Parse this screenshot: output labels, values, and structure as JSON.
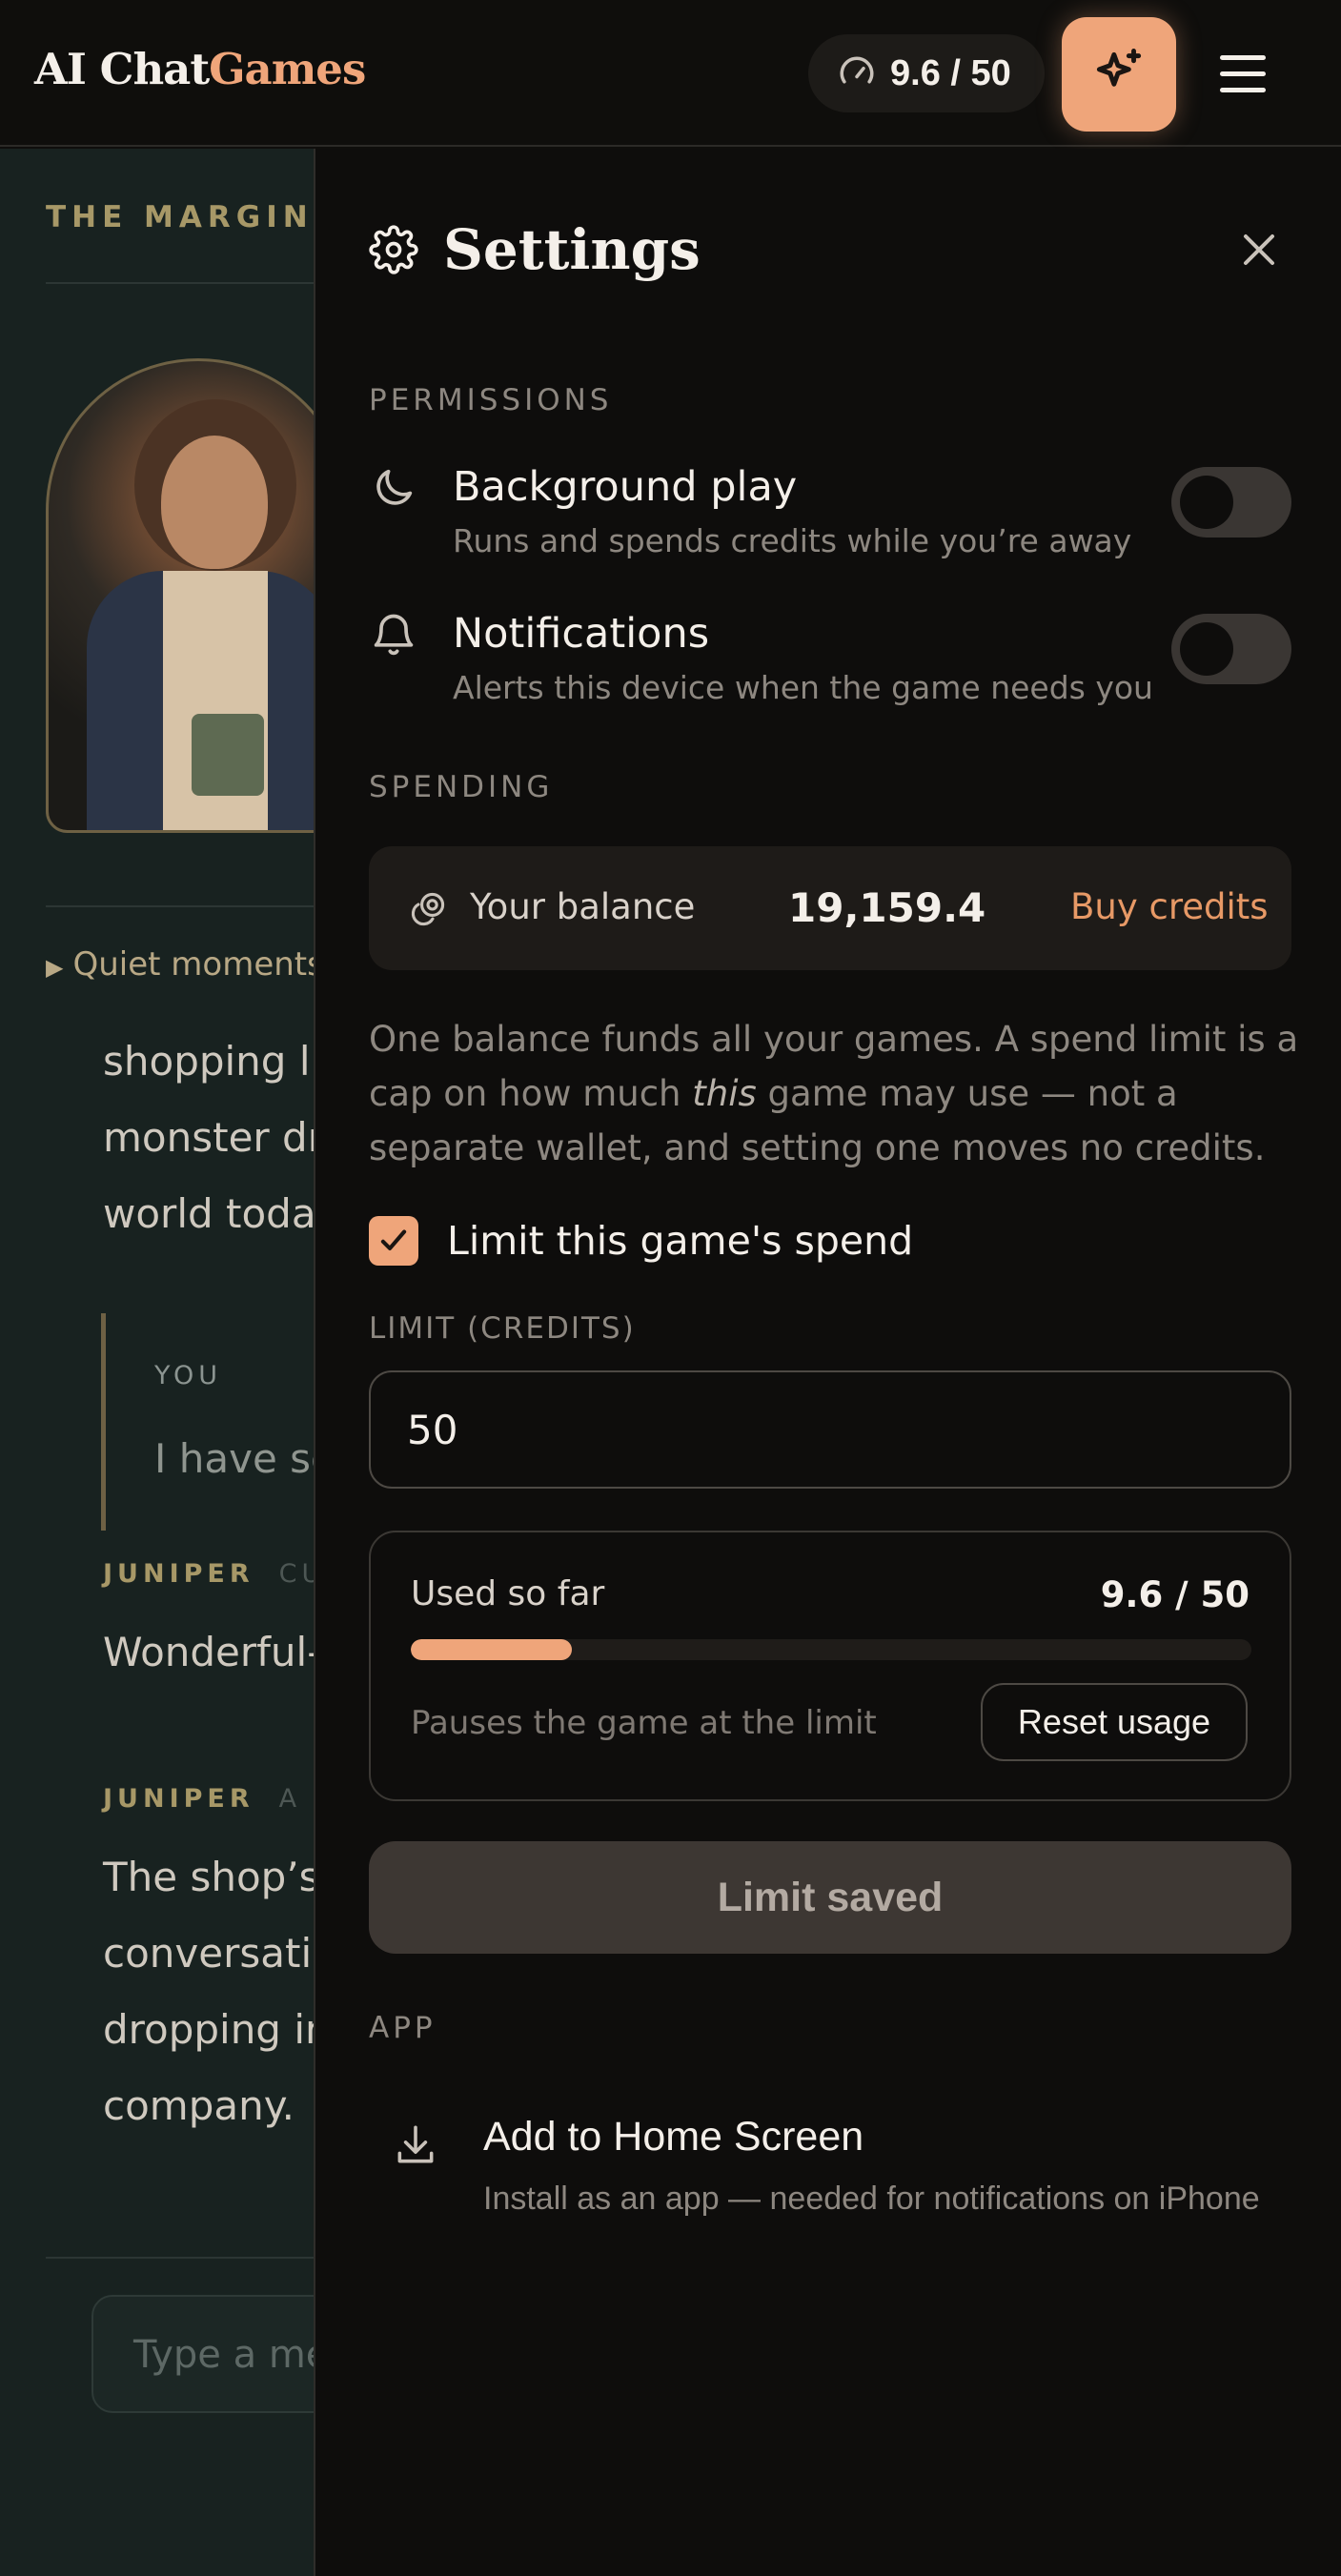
{
  "header": {
    "brand_primary": "AI Chat",
    "brand_secondary": "Games",
    "credits_display": "9.6 / 50",
    "sparkle_icon": "sparkles-icon",
    "menu_icon": "hamburger-icon",
    "colors": {
      "accent": "#efa57a",
      "background": "#0f0e0c"
    }
  },
  "background_page": {
    "title": "THE MARGIN",
    "portrait_icon": "character-portrait",
    "section_toggle": "Quiet moments",
    "story_lines": [
      "shopping li",
      "monster dr",
      "world today"
    ],
    "you_label": "YOU",
    "you_text": "I have so",
    "messages": [
      {
        "speaker": "JUNIPER",
        "meta": "CU",
        "lines": [
          "Wonderful-"
        ]
      },
      {
        "speaker": "JUNIPER",
        "meta": "A",
        "lines": [
          "The shop’s",
          "conversatio",
          "dropping in",
          "company."
        ]
      }
    ],
    "input_placeholder": "Type a me"
  },
  "settings": {
    "title": "Settings",
    "title_icon": "gear-icon",
    "close_icon": "close-icon",
    "permissions_label": "PERMISSIONS",
    "background_play": {
      "icon": "moon-icon",
      "title": "Background play",
      "subtitle": "Runs and spends credits while you’re away",
      "enabled": false
    },
    "notifications": {
      "icon": "bell-icon",
      "title": "Notifications",
      "subtitle": "Alerts this device when the game needs you",
      "enabled": false
    },
    "spending_label": "SPENDING",
    "balance": {
      "icon": "coins-icon",
      "label": "Your balance",
      "value": "19,159.4",
      "buy_label": "Buy credits"
    },
    "explanation": {
      "before": "One balance funds all your games. A spend limit is a cap on how much ",
      "emphasis": "this",
      "after": " game may use — not a separate wallet, and setting one moves no credits."
    },
    "limit_checkbox": {
      "label": "Limit this game's spend",
      "checked": true
    },
    "limit_field": {
      "label": "LIMIT (CREDITS)",
      "value": "50"
    },
    "usage": {
      "label": "Used so far",
      "value": "9.6 / 50",
      "fraction": 0.192,
      "note": "Pauses the game at the limit",
      "reset_label": "Reset usage"
    },
    "save_button": "Limit saved",
    "app_label": "APP",
    "add_home": {
      "icon": "download-icon",
      "title": "Add to Home Screen",
      "subtitle": "Install as an app — needed for notifications on iPhone"
    }
  }
}
